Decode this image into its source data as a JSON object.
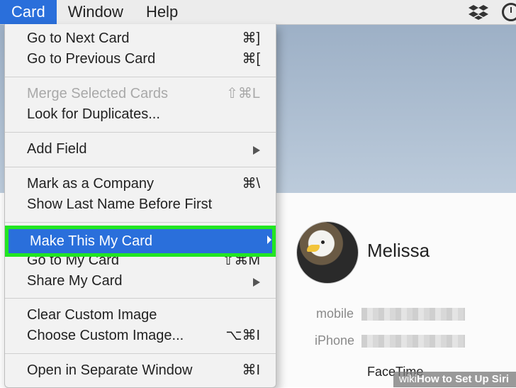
{
  "menubar": {
    "items": [
      {
        "label": "Card",
        "active": true
      },
      {
        "label": "Window",
        "active": false
      },
      {
        "label": "Help",
        "active": false
      }
    ],
    "icons": [
      "dropbox-icon",
      "time-machine-icon"
    ]
  },
  "menu": {
    "go_next": {
      "label": "Go to Next Card",
      "shortcut": "⌘]"
    },
    "go_prev": {
      "label": "Go to Previous Card",
      "shortcut": "⌘["
    },
    "merge": {
      "label": "Merge Selected Cards",
      "shortcut": "⇧⌘L",
      "disabled": true
    },
    "duplicates": {
      "label": "Look for Duplicates..."
    },
    "add_field": {
      "label": "Add Field",
      "submenu": true
    },
    "mark_company": {
      "label": "Mark as a Company",
      "shortcut": "⌘\\"
    },
    "show_last": {
      "label": "Show Last Name Before First"
    },
    "make_my_card": {
      "label": "Make This My Card",
      "highlighted": true
    },
    "go_my_card": {
      "label": "Go to My Card",
      "shortcut": "⇧⌘M"
    },
    "share": {
      "label": "Share My Card",
      "submenu": true
    },
    "clear_image": {
      "label": "Clear Custom Image"
    },
    "choose_image": {
      "label": "Choose Custom Image...",
      "shortcut": "⌥⌘I"
    },
    "open_separate": {
      "label": "Open in Separate Window",
      "shortcut": "⌘I"
    }
  },
  "contact": {
    "name": "Melissa",
    "fields": [
      {
        "label": "mobile"
      },
      {
        "label": "iPhone"
      }
    ],
    "facetime_label": "FaceTime"
  },
  "watermark": {
    "prefix": "wiki",
    "title": "How to Set Up Siri"
  },
  "colors": {
    "highlight": "#2a6fdb",
    "outline": "#22e622"
  }
}
